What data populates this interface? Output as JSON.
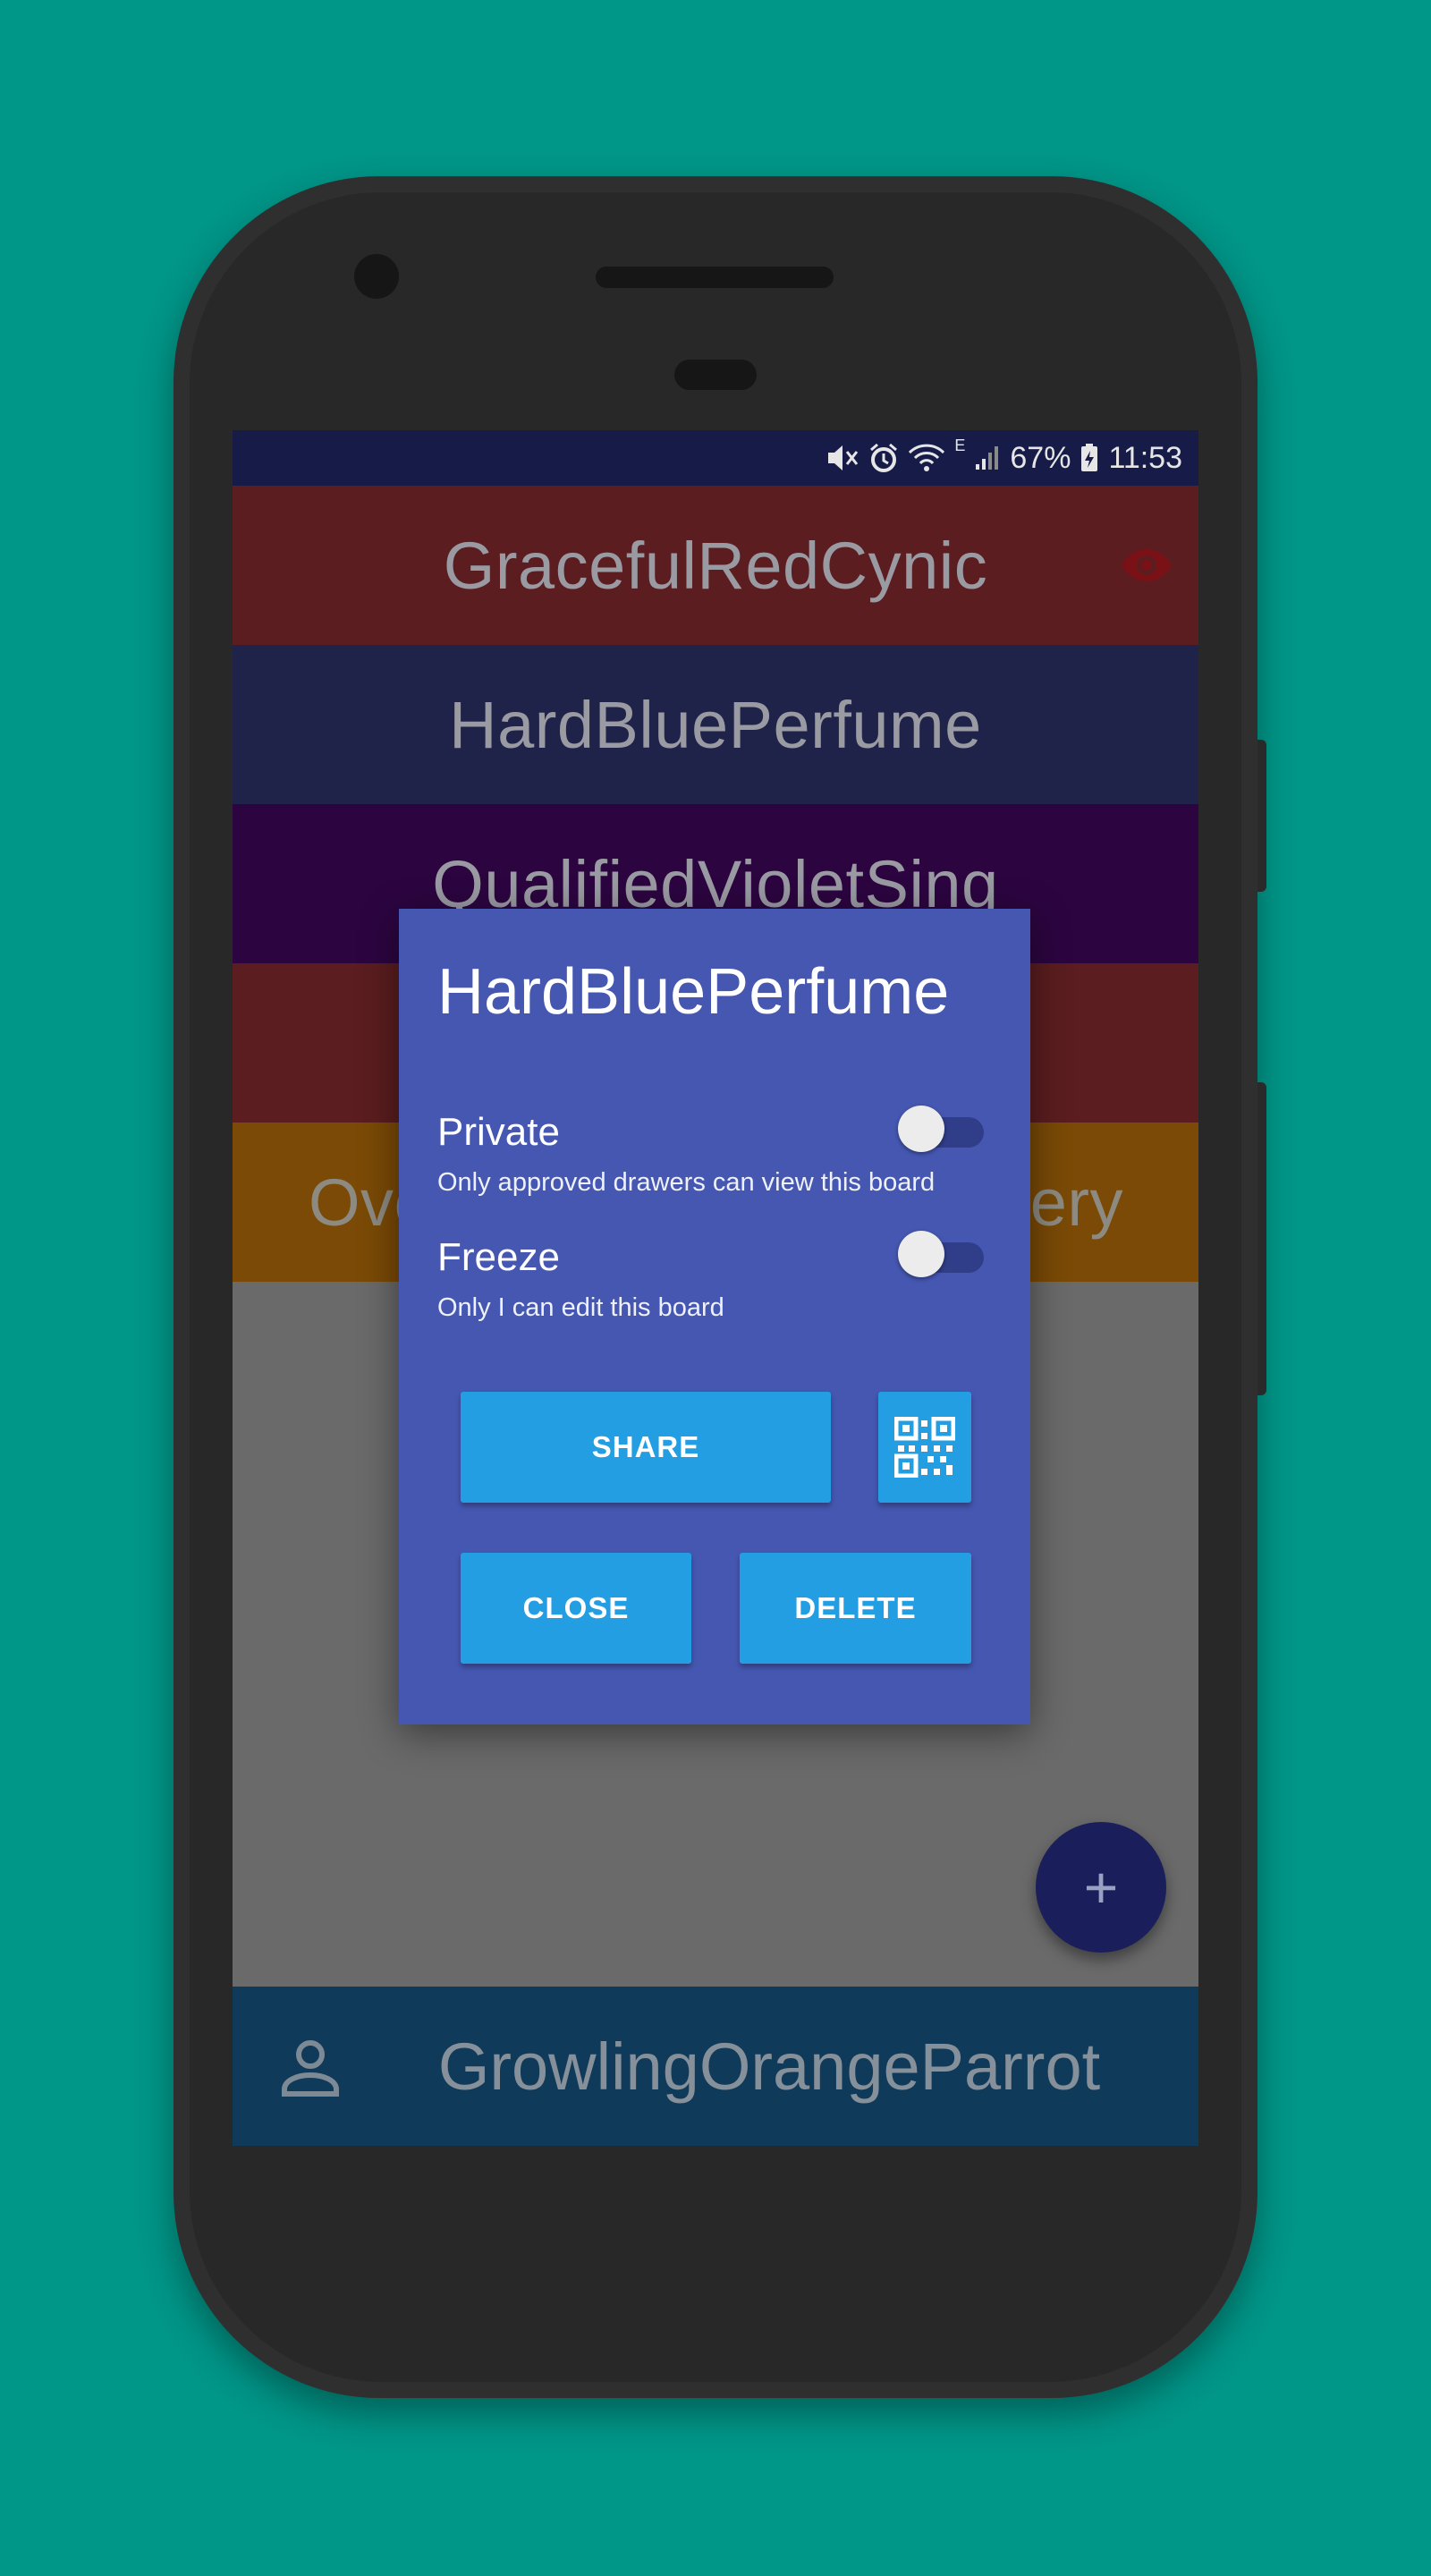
{
  "statusbar": {
    "battery_percent": "67%",
    "time": "11:53",
    "network_type": "E",
    "icons": [
      "mute-icon",
      "alarm-icon",
      "wifi-icon",
      "signal-icon",
      "battery-charging-icon"
    ]
  },
  "boards": [
    {
      "name": "GracefulRedCynic",
      "color": "#5b1d1f"
    },
    {
      "name": "HardBluePerfume",
      "color": "#1f2249"
    },
    {
      "name": "QualifiedVioletSing",
      "color": "#2c0540"
    },
    {
      "name": "",
      "color": "#5b1d1f"
    },
    {
      "name": "Ove",
      "name_end": "ery",
      "color": "#7a4a06"
    }
  ],
  "bottom_bar": {
    "username": "GrowlingOrangeParrot",
    "color": "#0f3a5a"
  },
  "fab": {
    "label": "+"
  },
  "dialog": {
    "title": "HardBluePerfume",
    "private": {
      "label": "Private",
      "description": "Only approved drawers can view this board",
      "enabled": false
    },
    "freeze": {
      "label": "Freeze",
      "description": "Only I can edit this board",
      "enabled": false
    },
    "share_label": "SHARE",
    "close_label": "CLOSE",
    "delete_label": "DELETE",
    "qr_icon": "qr-code-icon"
  },
  "colors": {
    "background": "#009688",
    "dialog": "#4557b1",
    "button": "#239ee2"
  }
}
